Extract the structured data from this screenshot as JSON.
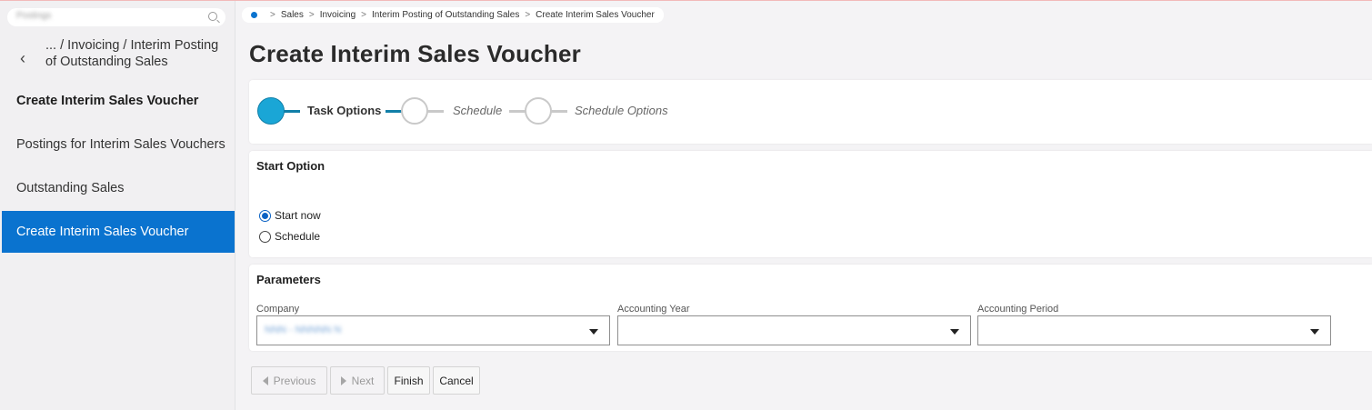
{
  "sidebar": {
    "search_blurred": "Postings",
    "back_label": "... / Invoicing / Interim Posting of Outstanding Sales",
    "items": [
      {
        "label": "Create Interim Sales Voucher"
      },
      {
        "label": "Postings for Interim Sales Vouchers"
      },
      {
        "label": "Outstanding Sales"
      },
      {
        "label": "Create Interim Sales Voucher"
      }
    ]
  },
  "breadcrumb": [
    "Sales",
    "Invoicing",
    "Interim Posting of Outstanding Sales",
    "Create Interim Sales Voucher"
  ],
  "page_title": "Create Interim Sales Voucher",
  "steps": [
    {
      "label": "Task Options",
      "state": "active"
    },
    {
      "label": "Schedule",
      "state": "inactive"
    },
    {
      "label": "Schedule Options",
      "state": "inactive"
    }
  ],
  "start_option": {
    "title": "Start Option",
    "options": [
      {
        "label": "Start now",
        "checked": true
      },
      {
        "label": "Schedule",
        "checked": false
      }
    ]
  },
  "parameters": {
    "title": "Parameters",
    "fields": [
      {
        "label": "Company",
        "value": "NNN - NNNNN N"
      },
      {
        "label": "Accounting Year",
        "value": ""
      },
      {
        "label": "Accounting Period",
        "value": ""
      }
    ]
  },
  "buttons": {
    "previous": "Previous",
    "next": "Next",
    "finish": "Finish",
    "cancel": "Cancel"
  },
  "colors": {
    "accent": "#0a73cf",
    "step_active": "#1aa6d6"
  }
}
